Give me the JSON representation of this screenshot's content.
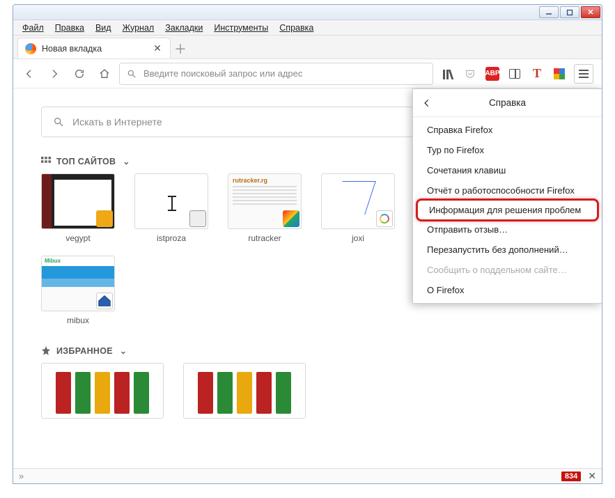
{
  "menubar": {
    "file": "Файл",
    "edit": "Правка",
    "view": "Вид",
    "history": "Журнал",
    "bookmarks": "Закладки",
    "tools": "Инструменты",
    "help": "Справка"
  },
  "tab": {
    "title": "Новая вкладка"
  },
  "urlbar": {
    "placeholder": "Введите поисковый запрос или адрес"
  },
  "search": {
    "placeholder": "Искать в Интернете"
  },
  "sections": {
    "topsites": "ТОП САЙТОВ",
    "highlights": "ИЗБРАННОЕ"
  },
  "tiles": {
    "vegypt": "vegypt",
    "istproza": "istproza",
    "rutracker": "rutracker",
    "rutracker_logo": "rutracker.rg",
    "joxi": "joxi",
    "mibux": "mibux",
    "mibux_logo": "Mibux"
  },
  "help_panel": {
    "title": "Справка",
    "items": {
      "firefox_help": "Справка Firefox",
      "tour": "Тур по Firefox",
      "shortcuts": "Сочетания клавиш",
      "health": "Отчёт о работоспособности Firefox",
      "troubleshoot": "Информация для решения проблем",
      "feedback": "Отправить отзыв…",
      "safe_mode": "Перезапустить без дополнений…",
      "report_site": "Сообщить о поддельном сайте…",
      "about": "О Firefox"
    }
  },
  "statusbar": {
    "count": "834"
  },
  "toolbar_icons": {
    "adblock": "ABP",
    "t": "T"
  }
}
